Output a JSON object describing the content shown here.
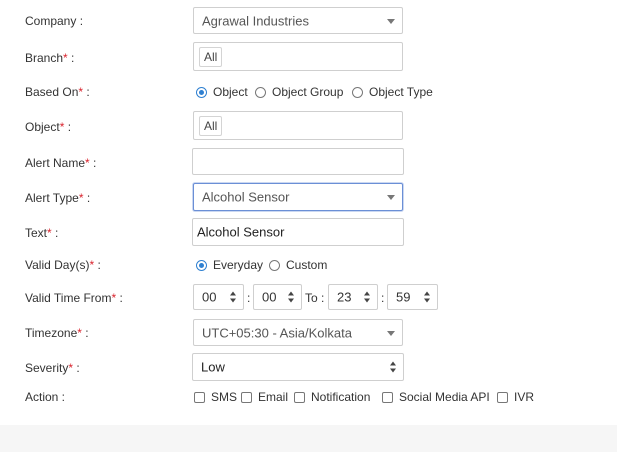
{
  "labels": {
    "company": "Company :",
    "branch": "Branch",
    "based_on": "Based On",
    "object": "Object",
    "alert_name": "Alert Name",
    "alert_type": "Alert Type",
    "text": "Text",
    "valid_days": "Valid Day(s)",
    "valid_time_from": "Valid Time From",
    "timezone": "Timezone",
    "severity": "Severity",
    "action": "Action :",
    "required_mark": "*",
    "colon": " :"
  },
  "fields": {
    "company": {
      "value": "Agrawal Industries"
    },
    "branch": {
      "chip": "All"
    },
    "based_on": {
      "options": [
        "Object",
        "Object Group",
        "Object Type"
      ],
      "selected": "Object"
    },
    "object": {
      "chip": "All"
    },
    "alert_name": {
      "value": ""
    },
    "alert_type": {
      "value": "Alcohol Sensor"
    },
    "text": {
      "value": "Alcohol Sensor"
    },
    "valid_days": {
      "options": [
        "Everyday",
        "Custom"
      ],
      "selected": "Everyday"
    },
    "valid_time": {
      "from_hour": "00",
      "from_minute": "00",
      "to_label": "To :",
      "to_hour": "23",
      "to_minute": "59",
      "colon": ":"
    },
    "timezone": {
      "value": "UTC+05:30 - Asia/Kolkata"
    },
    "severity": {
      "value": "Low"
    },
    "action": {
      "options": [
        "SMS",
        "Email",
        "Notification",
        "Social Media API",
        "IVR"
      ],
      "checked": []
    }
  },
  "colors": {
    "required": "#d9232d",
    "radio_selected": "#2f80d1",
    "focus_border": "#6b8fd6"
  }
}
